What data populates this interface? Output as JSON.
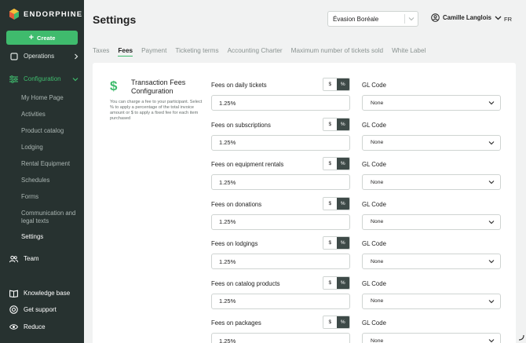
{
  "app": {
    "brand": "ENDORPHINE",
    "page_title": "Settings",
    "create_label": "Create"
  },
  "sidebar": {
    "operations_label": "Operations",
    "configuration_label": "Configuration",
    "sub_items": [
      "My Home Page",
      "Activities",
      "Product catalog",
      "Lodging",
      "Rental Equipment",
      "Schedules",
      "Forms",
      "Communication and legal texts",
      "Settings"
    ],
    "team_label": "Team",
    "bottom_items": [
      "Knowledge base",
      "Get support",
      "Reduce"
    ]
  },
  "header": {
    "org_name": "Évasion Boréale",
    "user_name": "Camille Langlois",
    "lang": "FR"
  },
  "tabs": [
    "Taxes",
    "Fees",
    "Payment",
    "Ticketing terms",
    "Accounting Charter",
    "Maximum number of tickets sold",
    "White Label"
  ],
  "active_tab": "Fees",
  "section": {
    "title": "Transaction Fees Configuration",
    "description": "You can charge a fee to your participant. Select % to apply a percentage of the total invoice amount or $ to apply a fixed fee for each item purchased"
  },
  "toggle": {
    "dollar": "$",
    "percent": "%"
  },
  "gl_label": "GL Code",
  "fees": [
    {
      "label": "Fees on daily tickets",
      "value": "1.25%",
      "gl": "None"
    },
    {
      "label": "Fees on subscriptions",
      "value": "1.25%",
      "gl": "None"
    },
    {
      "label": "Fees on equipment rentals",
      "value": "1.25%",
      "gl": "None"
    },
    {
      "label": "Fees on donations",
      "value": "1.25%",
      "gl": "None"
    },
    {
      "label": "Fees on lodgings",
      "value": "1.25%",
      "gl": "None"
    },
    {
      "label": "Fees on catalog products",
      "value": "1.25%",
      "gl": "None"
    },
    {
      "label": "Fees on packages",
      "value": "1.25%",
      "gl": "None"
    }
  ],
  "colors": {
    "sidebar_bg": "#273230",
    "accent": "#3fbb6d",
    "toggle_active": "#3e4a48"
  }
}
